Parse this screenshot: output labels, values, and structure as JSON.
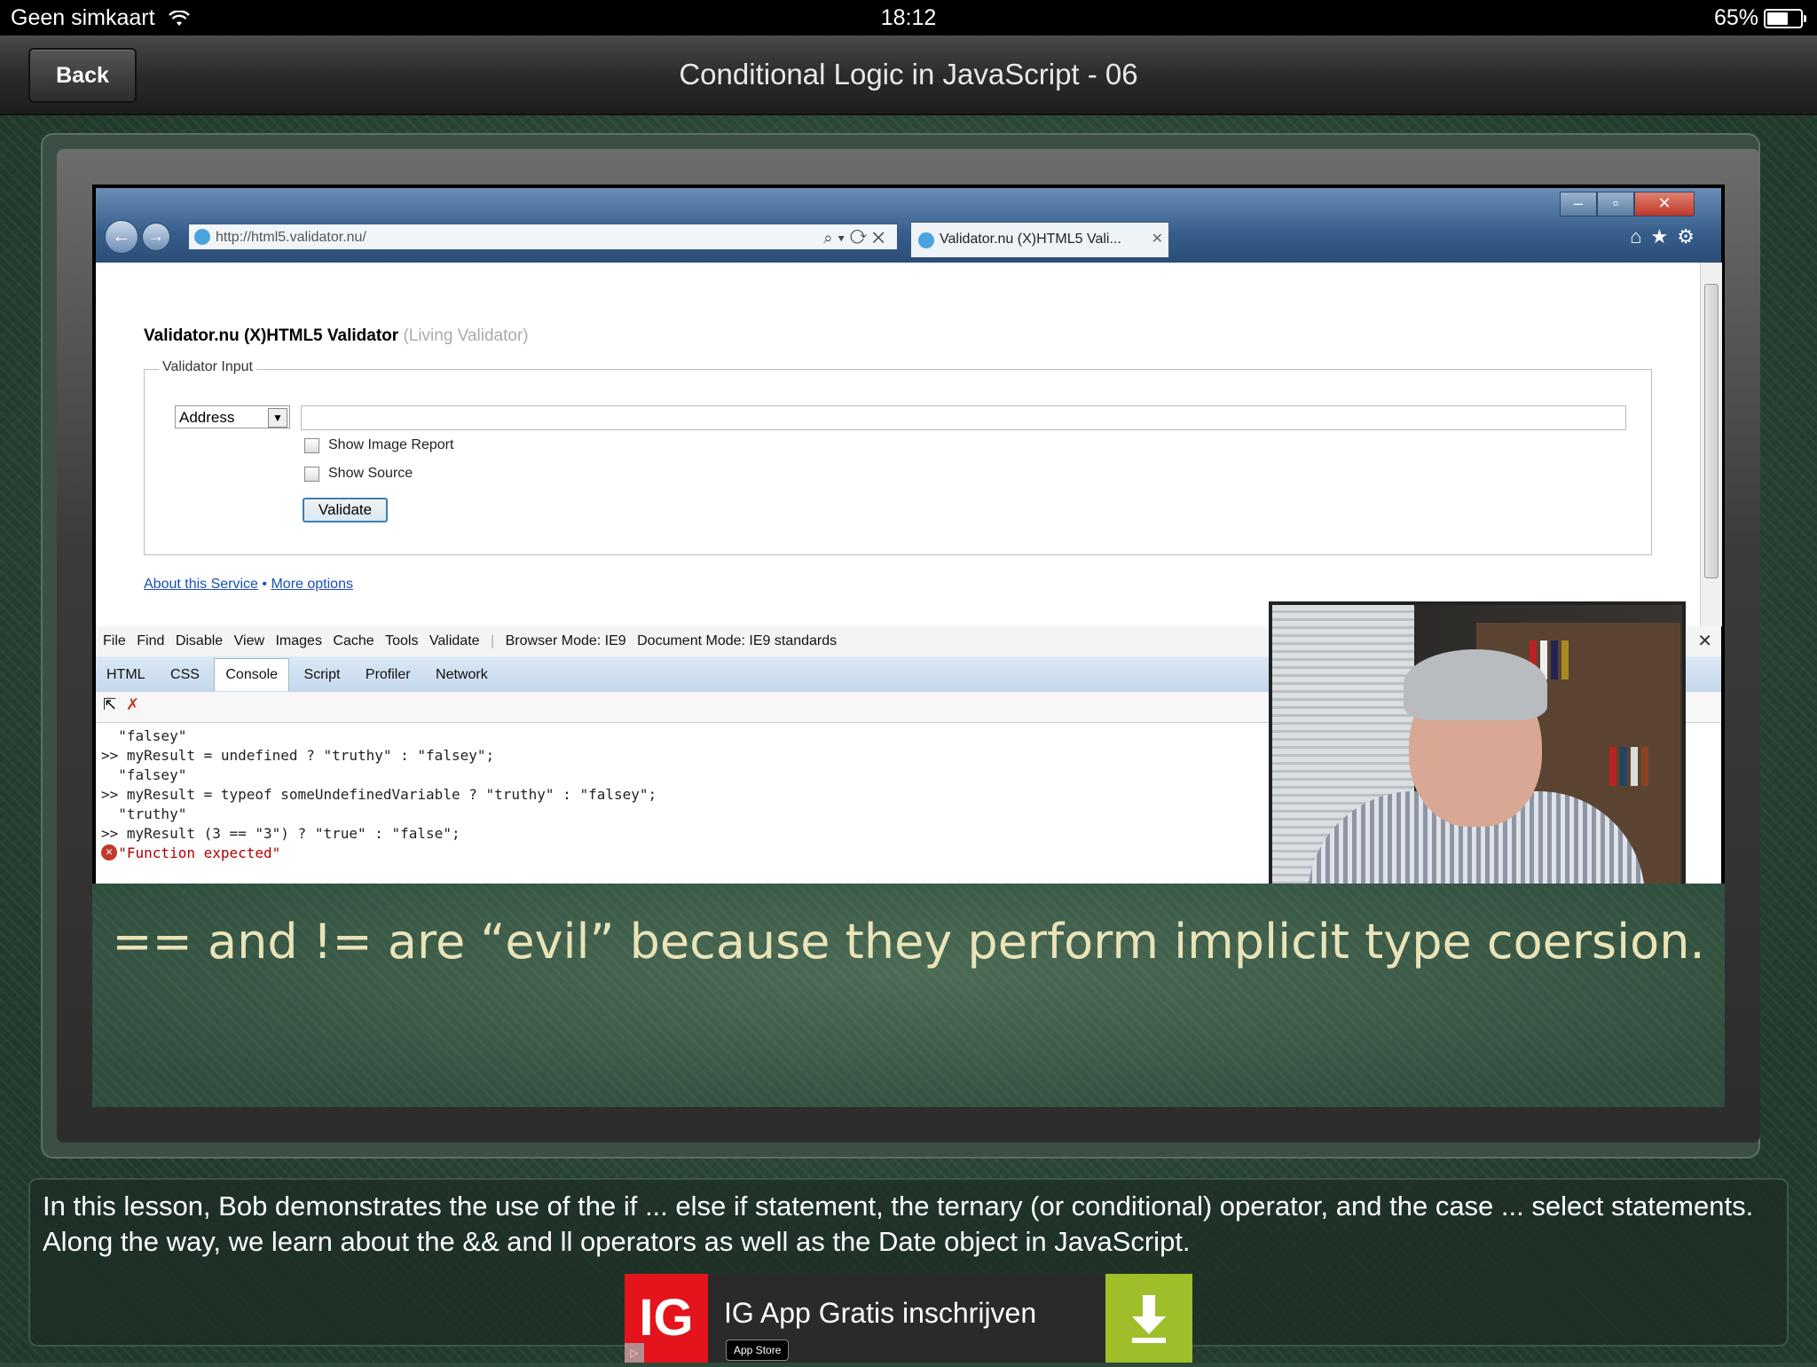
{
  "status_bar": {
    "carrier": "Geen simkaart",
    "time": "18:12",
    "battery_percent": "65%",
    "battery_level": 0.65
  },
  "nav": {
    "back_label": "Back",
    "title": "Conditional Logic in JavaScript - 06"
  },
  "browser": {
    "url": "http://html5.validator.nu/",
    "tab_title": "Validator.nu (X)HTML5 Vali...",
    "page": {
      "title": "Validator.nu (X)HTML5 Validator",
      "subtitle": "(Living Validator)",
      "legend": "Validator Input",
      "select_value": "Address",
      "checkbox_image_report": "Show Image Report",
      "checkbox_show_source": "Show Source",
      "validate_button": "Validate",
      "link_about": "About this Service",
      "link_separator": "•",
      "link_more": "More options"
    },
    "devtools": {
      "menu": [
        "File",
        "Find",
        "Disable",
        "View",
        "Images",
        "Cache",
        "Tools",
        "Validate"
      ],
      "browser_mode": "Browser Mode: IE9",
      "document_mode": "Document Mode: IE9 standards",
      "tabs": [
        "HTML",
        "CSS",
        "Console",
        "Script",
        "Profiler",
        "Network"
      ],
      "active_tab": "Console",
      "console_lines": [
        {
          "text": "  \"falsey\"",
          "type": "out"
        },
        {
          "text": ">> myResult = undefined ? \"truthy\" : \"falsey\";",
          "type": "in"
        },
        {
          "text": "  \"falsey\"",
          "type": "out"
        },
        {
          "text": ">> myResult = typeof someUndefinedVariable ? \"truthy\" : \"falsey\";",
          "type": "in"
        },
        {
          "text": "  \"truthy\"",
          "type": "out"
        },
        {
          "text": ">> myResult (3 == \"3\") ? \"true\" : \"false\";",
          "type": "in"
        },
        {
          "text": "  \"Function expected\"",
          "type": "err"
        }
      ]
    }
  },
  "caption": "== and != are “evil” because they perform implicit type coersion.",
  "description": "In this lesson, Bob demonstrates the use of the if ... else if statement, the ternary (or conditional) operator, and the case ... select statements. Along the way, we learn about the && and ll operators as well as the Date object in JavaScript.",
  "ad": {
    "logo": "IG",
    "text": "IG App Gratis inschrijven",
    "store_badge": "App Store"
  },
  "colors": {
    "ad_red": "#e3141b",
    "ad_green": "#9ebf2a",
    "caption_text": "#e9e3b8"
  }
}
